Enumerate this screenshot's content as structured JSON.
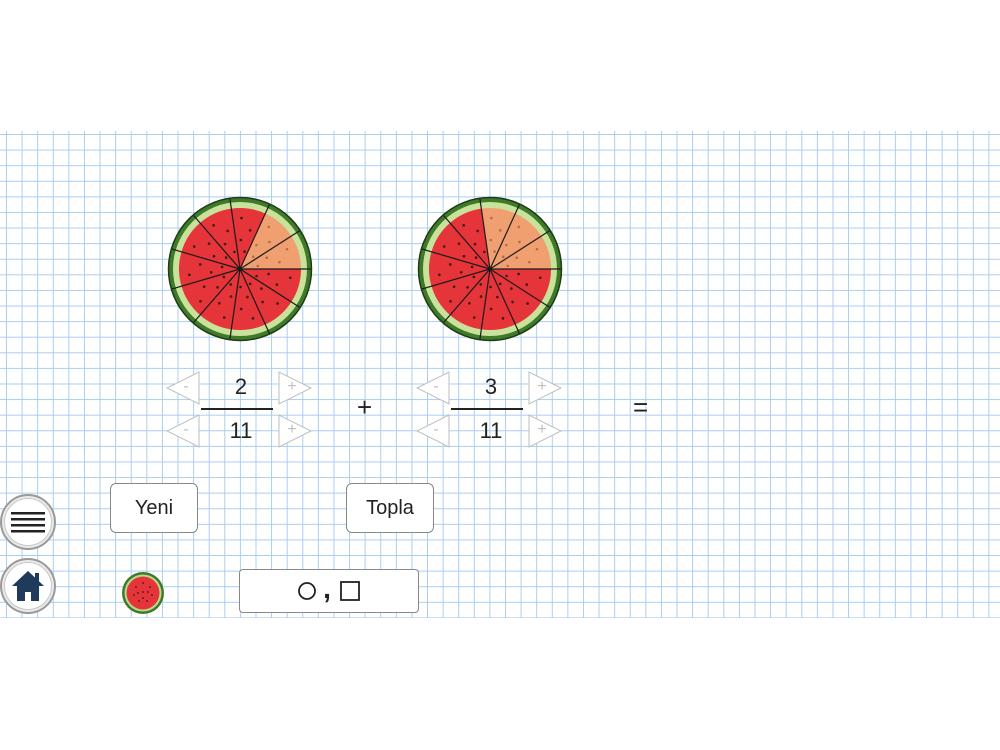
{
  "fraction1": {
    "numerator": "2",
    "denominator": "11",
    "minus_label": "-",
    "plus_label": "+"
  },
  "fraction2": {
    "numerator": "3",
    "denominator": "11",
    "minus_label": "-",
    "plus_label": "+"
  },
  "operator": "+",
  "equals": "=",
  "buttons": {
    "new_label": "Yeni",
    "add_label": "Topla"
  },
  "mode_toggle": {
    "label": "○, □",
    "separator": ","
  },
  "icons": {
    "menu": "hamburger-menu-icon",
    "home": "home-icon",
    "watermelon": "watermelon-icon"
  },
  "colors": {
    "grid_line": "#a9cdf0",
    "flesh": "#e5353a",
    "selected_flesh": "#f0a070",
    "rind": "#3f7a2a"
  }
}
